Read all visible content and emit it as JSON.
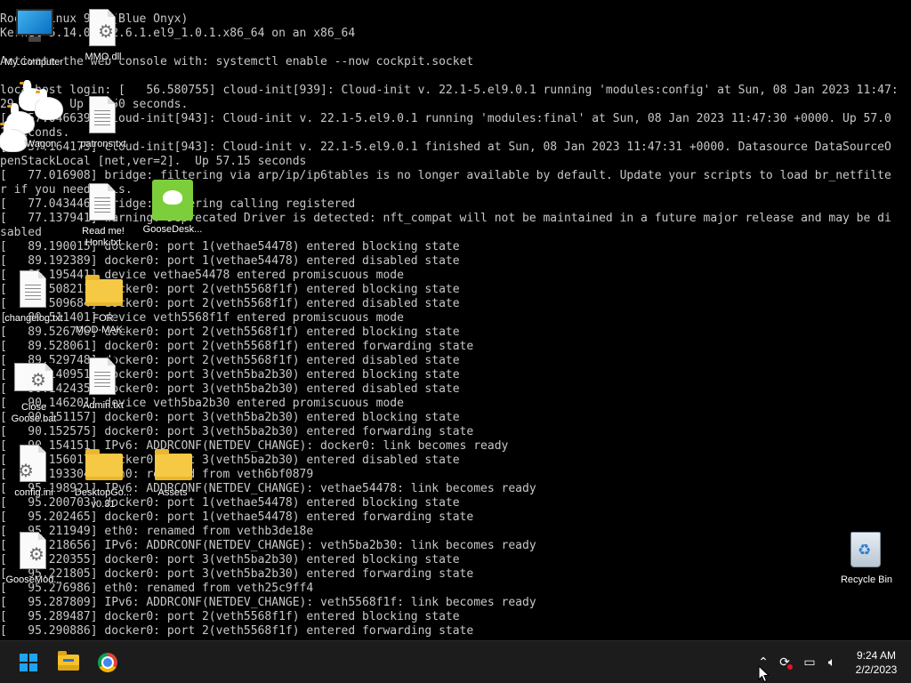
{
  "console": {
    "lines": [
      "Rocky Linux 9.1 (Blue Onyx)",
      "Kernel 5.14.0-162.6.1.el9_1.0.1.x86_64 on an x86_64",
      "",
      "Activate the web console with: systemctl enable --now cockpit.socket",
      "",
      "localhost login: [   56.580755] cloud-init[939]: Cloud-init v. 22.1-5.el9.0.1 running 'modules:config' at Sun, 08 Jan 2023 11:47:",
      "29 +0000. Up 56.50 seconds.",
      "[   57.046639] cloud-init[943]: Cloud-init v. 22.1-5.el9.0.1 running 'modules:final' at Sun, 08 Jan 2023 11:47:30 +0000. Up 57.0",
      "1 seconds.",
      "[   57.164173] cloud-init[943]: Cloud-init v. 22.1-5.el9.0.1 finished at Sun, 08 Jan 2023 11:47:31 +0000. Datasource DataSourceO",
      "penStackLocal [net,ver=2].  Up 57.15 seconds",
      "[   77.016908] bridge: filtering via arp/ip/ip6tables is no longer available by default. Update your scripts to load br_netfilte",
      "r if you need this.",
      "[   77.043446] bridge: filtering calling registered",
      "[   77.137941] warning: Deprecated Driver is detected: nft_compat will not be maintained in a future major release and may be di",
      "sabled",
      "[   89.190015] docker0: port 1(vethae54478) entered blocking state",
      "[   89.192389] docker0: port 1(vethae54478) entered disabled state",
      "[   89.195441] device vethae54478 entered promiscuous mode",
      "[   89.508211] docker0: port 2(veth5568f1f) entered blocking state",
      "[   89.509684] docker0: port 2(veth5568f1f) entered disabled state",
      "[   89.511401] device veth5568f1f entered promiscuous mode",
      "[   89.526706] docker0: port 2(veth5568f1f) entered blocking state",
      "[   89.528061] docker0: port 2(veth5568f1f) entered forwarding state",
      "[   89.529748] docker0: port 2(veth5568f1f) entered disabled state",
      "[   90.140951] docker0: port 3(veth5ba2b30) entered blocking state",
      "[   90.142435] docker0: port 3(veth5ba2b30) entered disabled state",
      "[   90.146201] device veth5ba2b30 entered promiscuous mode",
      "[   90.151157] docker0: port 3(veth5ba2b30) entered blocking state",
      "[   90.152575] docker0: port 3(veth5ba2b30) entered forwarding state",
      "[   90.154151] IPv6: ADDRCONF(NETDEV_CHANGE): docker0: link becomes ready",
      "[   90.156017] docker0: port 3(veth5ba2b30) entered disabled state",
      "[   95.193304] eth0: renamed from veth6bf0879",
      "[   95.198921] IPv6: ADDRCONF(NETDEV_CHANGE): vethae54478: link becomes ready",
      "[   95.200703] docker0: port 1(vethae54478) entered blocking state",
      "[   95.202465] docker0: port 1(vethae54478) entered forwarding state",
      "[   95.211949] eth0: renamed from vethb3de18e",
      "[   95.218656] IPv6: ADDRCONF(NETDEV_CHANGE): veth5ba2b30: link becomes ready",
      "[   95.220355] docker0: port 3(veth5ba2b30) entered blocking state",
      "[   95.221805] docker0: port 3(veth5ba2b30) entered forwarding state",
      "[   95.276986] eth0: renamed from veth25c9ff4",
      "[   95.287809] IPv6: ADDRCONF(NETDEV_CHANGE): veth5568f1f: link becomes ready",
      "[   95.289487] docker0: port 2(veth5568f1f) entered blocking state",
      "[   95.290886] docker0: port 2(veth5568f1f) entered forwarding state"
    ]
  },
  "desktop": {
    "icons": {
      "my_computer": "My Computer",
      "mmo_dll": "MMO.dll",
      "wagon": "Wagon",
      "patrons": "patrons.txt",
      "read_me_1": "Read me!",
      "read_me_2": "Honk.txt",
      "goose_desktop": "GooseDesk...",
      "changelog": "changelog.txt",
      "folder_1_line1": "FOR",
      "folder_1_line2": "MOD-MAK...",
      "close_goose_1": "Close",
      "close_goose_2": "Goose.bat",
      "admin": "Admin.txt",
      "config": "config.ini",
      "desktop_goose_1": "DesktopGo...",
      "desktop_goose_2": "v0.31",
      "assets": "Assets",
      "goose_mod": "GooseMod...",
      "recycle_bin": "Recycle Bin"
    }
  },
  "taskbar": {
    "pinned": [
      "start",
      "file-explorer",
      "chrome"
    ],
    "tray_icons": [
      "chevron-up-icon",
      "sync-icon",
      "network-icon",
      "volume-icon"
    ],
    "time": "9:24 AM",
    "date": "2/2/2023",
    "accent": "#1fa3f0"
  }
}
